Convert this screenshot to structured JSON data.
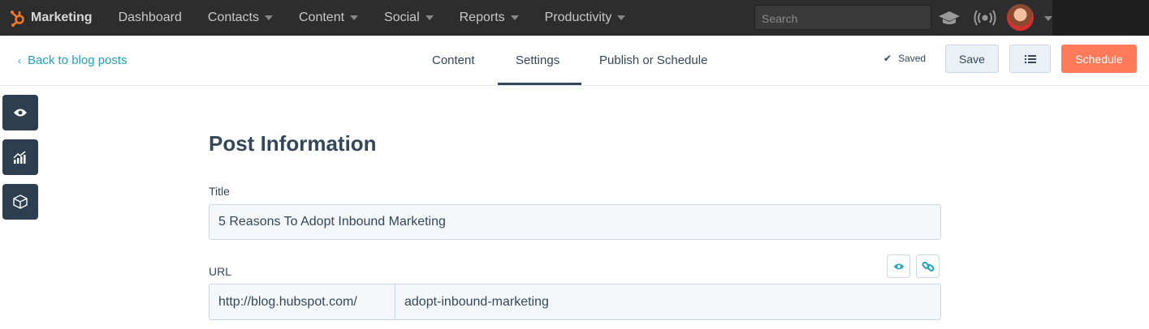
{
  "topnav": {
    "brand": "Marketing",
    "items": [
      {
        "label": "Dashboard",
        "dropdown": false
      },
      {
        "label": "Contacts",
        "dropdown": true
      },
      {
        "label": "Content",
        "dropdown": true
      },
      {
        "label": "Social",
        "dropdown": true
      },
      {
        "label": "Reports",
        "dropdown": true
      },
      {
        "label": "Productivity",
        "dropdown": true
      }
    ],
    "search_placeholder": "Search"
  },
  "toolbar": {
    "back": "Back to blog posts",
    "tabs": [
      "Content",
      "Settings",
      "Publish or Schedule"
    ],
    "active_tab": "Settings",
    "saved": "Saved",
    "save": "Save",
    "schedule": "Schedule"
  },
  "form": {
    "heading": "Post Information",
    "title_label": "Title",
    "title_value": "5 Reasons To Adopt Inbound Marketing",
    "url_label": "URL",
    "url_prefix": "http://blog.hubspot.com/",
    "url_slug": "adopt-inbound-marketing"
  },
  "colors": {
    "accent": "#1fa3bd",
    "primary": "#ff7a59",
    "text": "#33475b"
  }
}
